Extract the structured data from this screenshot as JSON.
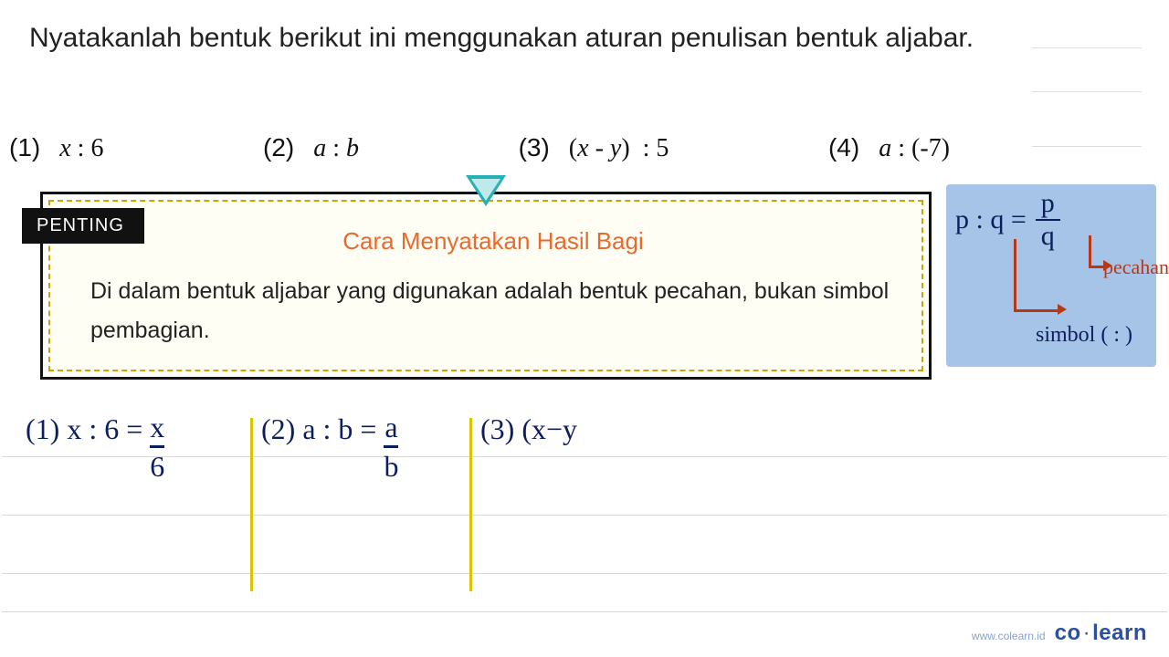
{
  "question": "Nyatakanlah bentuk berikut ini menggunakan aturan penulisan bentuk aljabar.",
  "options": {
    "o1": {
      "num": "(1)",
      "expr": "x : 6"
    },
    "o2": {
      "num": "(2)",
      "expr": "a : b"
    },
    "o3": {
      "num": "(3)",
      "expr": "(x - y)  : 5"
    },
    "o4": {
      "num": "(4)",
      "expr": "a : (-7)"
    }
  },
  "penting": "PENTING",
  "info": {
    "title": "Cara Menyatakan Hasil Bagi",
    "body": "Di dalam bentuk aljabar yang digunakan adalah bentuk pecahan, bukan simbol pembagian."
  },
  "bluenote": {
    "lhs": "p : q =",
    "frac_top": "p",
    "frac_bot": "q",
    "lab_pecahan": "pecahan",
    "lab_simbol": "simbol ( : )"
  },
  "work": {
    "a1": {
      "lbl": "(1)",
      "pre": "x : 6 =",
      "top": "x",
      "bot": "6"
    },
    "a2": {
      "lbl": "(2)",
      "pre": "a : b =",
      "top": "a",
      "bot": "b"
    },
    "a3": {
      "lbl": "(3)",
      "pre": "(x−y"
    }
  },
  "footer": {
    "site": "www.colearn.id",
    "brand_a": "co",
    "brand_b": "learn"
  }
}
